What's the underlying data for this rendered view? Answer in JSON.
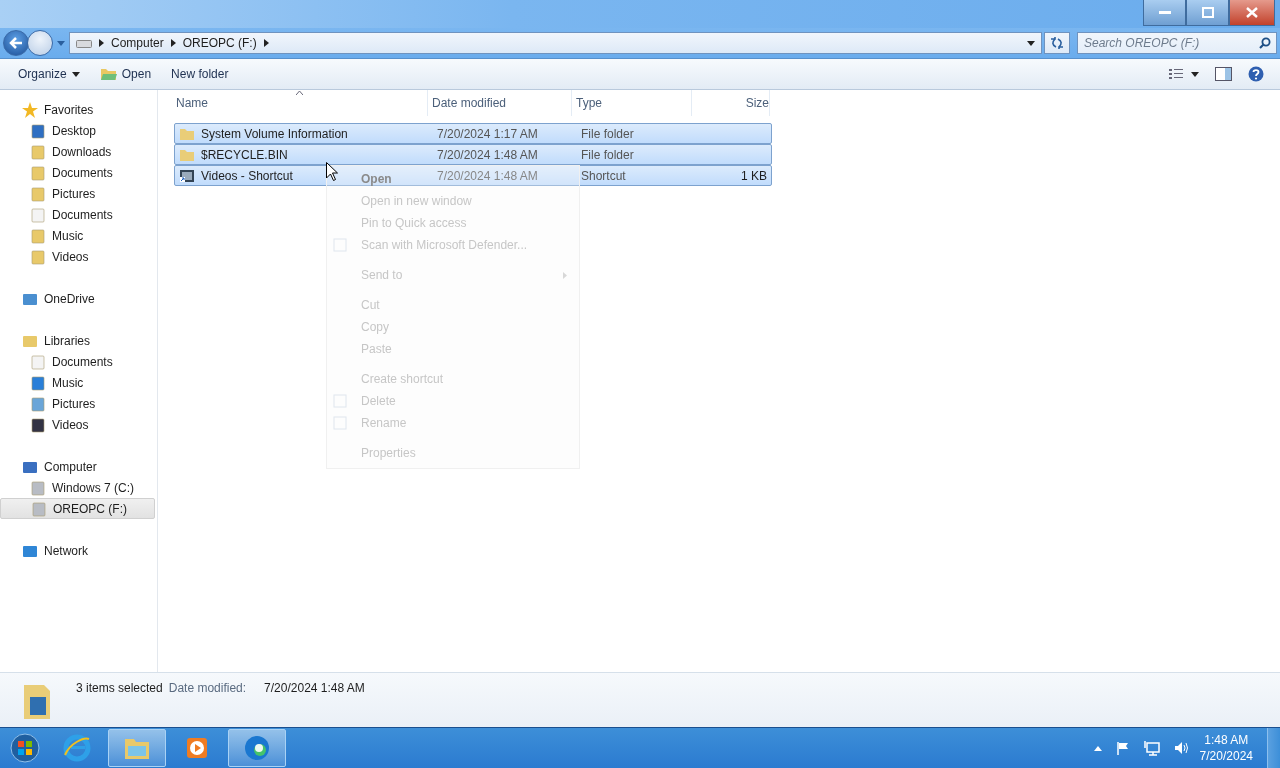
{
  "address": {
    "crumbs": [
      "Computer",
      "OREOPC (F:)"
    ]
  },
  "search": {
    "placeholder": "Search OREOPC (F:)"
  },
  "toolbar": {
    "buttons": [
      {
        "label": "Organize",
        "kind": "menu"
      },
      {
        "label": "Open",
        "kind": "open"
      },
      {
        "label": "New folder",
        "kind": "plain"
      }
    ]
  },
  "sidebar": {
    "groups": [
      {
        "label": "Favorites",
        "kind": "star",
        "children": [
          {
            "label": "Desktop",
            "kind": "desktop",
            "selected": false
          },
          {
            "label": "Downloads",
            "kind": "folder",
            "selected": false
          },
          {
            "label": "Documents",
            "kind": "folder",
            "selected": false
          },
          {
            "label": "Pictures",
            "kind": "folder",
            "selected": false
          },
          {
            "label": "Documents",
            "kind": "doc",
            "selected": false
          },
          {
            "label": "Music",
            "kind": "folder",
            "selected": false
          },
          {
            "label": "Videos",
            "kind": "folder",
            "selected": false
          }
        ]
      },
      {
        "label": "OneDrive",
        "kind": "cloud"
      },
      {
        "label": "Libraries",
        "kind": "library",
        "children": [
          {
            "label": "Documents",
            "kind": "doc",
            "selected": false
          },
          {
            "label": "Music",
            "kind": "music",
            "selected": false
          },
          {
            "label": "Pictures",
            "kind": "image",
            "selected": false
          },
          {
            "label": "Videos",
            "kind": "film",
            "selected": false
          }
        ]
      },
      {
        "label": "Computer",
        "kind": "computer",
        "children": [
          {
            "label": "Windows 7 (C:)",
            "kind": "drive",
            "selected": false
          },
          {
            "label": "OREOPC (F:)",
            "kind": "drive",
            "selected": true
          }
        ]
      },
      {
        "label": "Network",
        "kind": "network"
      }
    ]
  },
  "table": {
    "columns": [
      "Name",
      "Date modified",
      "Type",
      "Size"
    ],
    "rows": [
      {
        "name": "System Volume Information",
        "date": "7/20/2024 1:17 AM",
        "type": "File folder",
        "size": "",
        "kind": "folder",
        "selected": true
      },
      {
        "name": "$RECYCLE.BIN",
        "date": "7/20/2024 1:48 AM",
        "type": "File folder",
        "size": "",
        "kind": "folder",
        "selected": true
      },
      {
        "name": "Videos - Shortcut",
        "date": "7/20/2024 1:48 AM",
        "type": "Shortcut",
        "size": "1 KB",
        "kind": "shortcut",
        "selected": true
      }
    ]
  },
  "context_menu": {
    "groups": [
      [
        {
          "label": "Open",
          "default": true
        },
        {
          "label": "Open in new window"
        },
        {
          "label": "Pin to Quick access"
        },
        {
          "label": "Scan with Microsoft Defender...",
          "has_icon": true
        }
      ],
      [
        {
          "label": "Send to",
          "submenu": true
        }
      ],
      [
        {
          "label": "Cut"
        },
        {
          "label": "Copy"
        },
        {
          "label": "Paste"
        }
      ],
      [
        {
          "label": "Create shortcut"
        },
        {
          "label": "Delete",
          "has_icon": true
        },
        {
          "label": "Rename",
          "has_icon": true
        }
      ],
      [
        {
          "label": "Properties"
        }
      ]
    ]
  },
  "details": {
    "summary": "3 items selected",
    "field_label": "Date modified:",
    "field_value": "7/20/2024 1:48 AM"
  },
  "taskbar": {
    "apps": [
      {
        "kind": "browser-e",
        "active": false
      },
      {
        "kind": "explorer",
        "active": true
      },
      {
        "kind": "media",
        "active": false
      },
      {
        "kind": "edge",
        "active": true
      }
    ],
    "time": "1:48 AM",
    "date": "7/20/2024"
  }
}
